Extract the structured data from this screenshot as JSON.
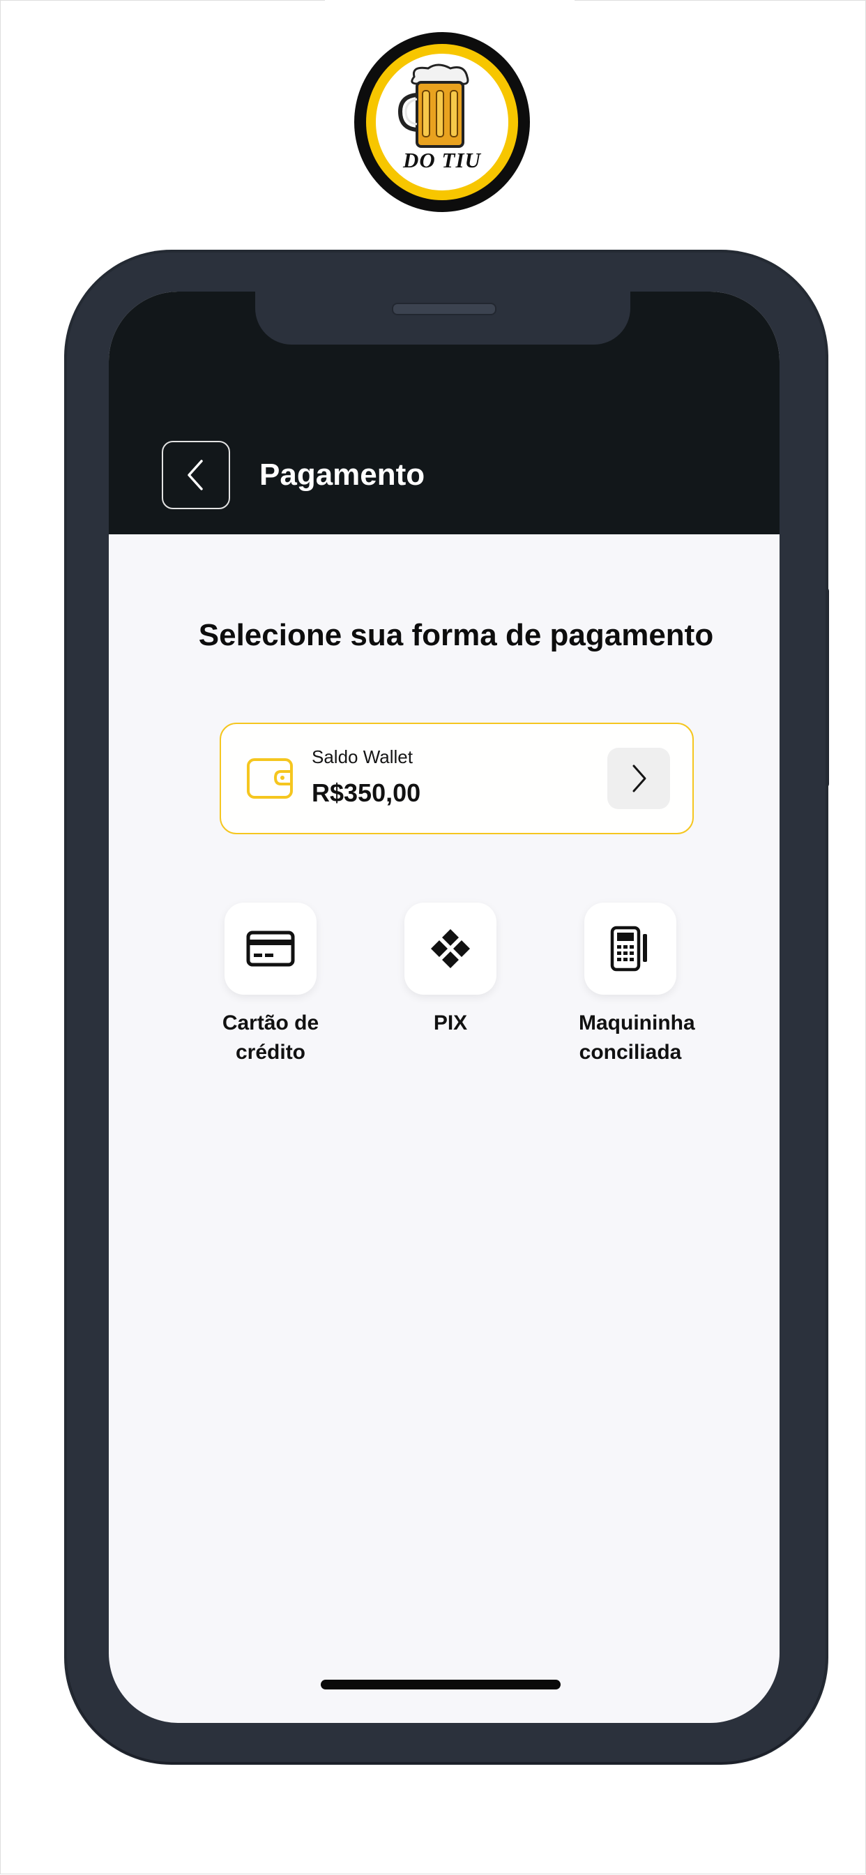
{
  "brand": {
    "logo_text": "DO TIU",
    "accent_color": "#f7c600"
  },
  "header": {
    "title": "Pagamento",
    "back_icon": "chevron-left-icon"
  },
  "main": {
    "section_title": "Selecione sua forma de pagamento",
    "wallet": {
      "label": "Saldo Wallet",
      "amount": "R$350,00",
      "icon": "wallet-icon",
      "arrow_icon": "chevron-right-icon"
    },
    "methods": [
      {
        "label": "Cartão de crédito",
        "icon": "credit-card-icon"
      },
      {
        "label": "PIX",
        "icon": "pix-icon"
      },
      {
        "label": "Maquininha conciliada",
        "icon": "card-machine-icon"
      }
    ]
  }
}
